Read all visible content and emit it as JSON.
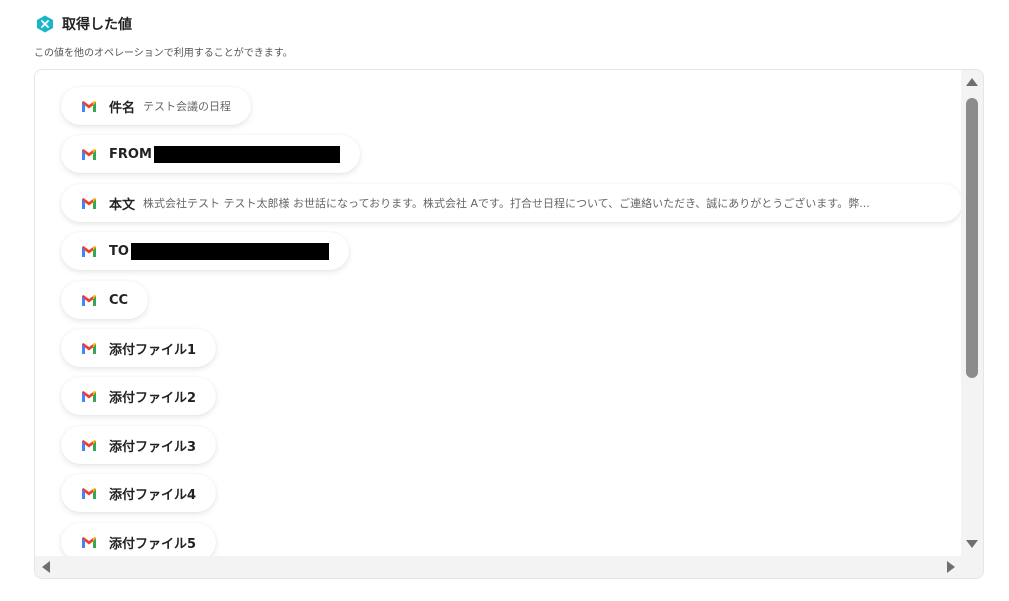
{
  "header": {
    "title": "取得した値",
    "subtitle": "この値を他のオペレーションで利用することができます。",
    "badge_icon": "variable-x-icon",
    "badge_color": "#1ab5c9"
  },
  "items": [
    {
      "label": "件名",
      "value": "テスト会議の日程",
      "icon": "gmail-icon"
    },
    {
      "label": "FROM",
      "value": "",
      "redacted": true,
      "icon": "gmail-icon"
    },
    {
      "label": "本文",
      "value": "株式会社テスト テスト太郎様 お世話になっております。株式会社 Aです。打合せ日程について、ご連絡いただき、誠にありがとうございます。弊...",
      "icon": "gmail-icon"
    },
    {
      "label": "TO",
      "value": "",
      "redacted": true,
      "icon": "gmail-icon"
    },
    {
      "label": "CC",
      "value": "",
      "icon": "gmail-icon"
    },
    {
      "label": "添付ファイル1",
      "value": "",
      "icon": "gmail-icon"
    },
    {
      "label": "添付ファイル2",
      "value": "",
      "icon": "gmail-icon"
    },
    {
      "label": "添付ファイル3",
      "value": "",
      "icon": "gmail-icon"
    },
    {
      "label": "添付ファイル4",
      "value": "",
      "icon": "gmail-icon"
    },
    {
      "label": "添付ファイル5",
      "value": "",
      "icon": "gmail-icon"
    }
  ],
  "colors": {
    "gmail_red": "#ea4335",
    "gmail_blue": "#4285f4",
    "gmail_green": "#34a853",
    "gmail_yellow": "#fbbc04"
  }
}
